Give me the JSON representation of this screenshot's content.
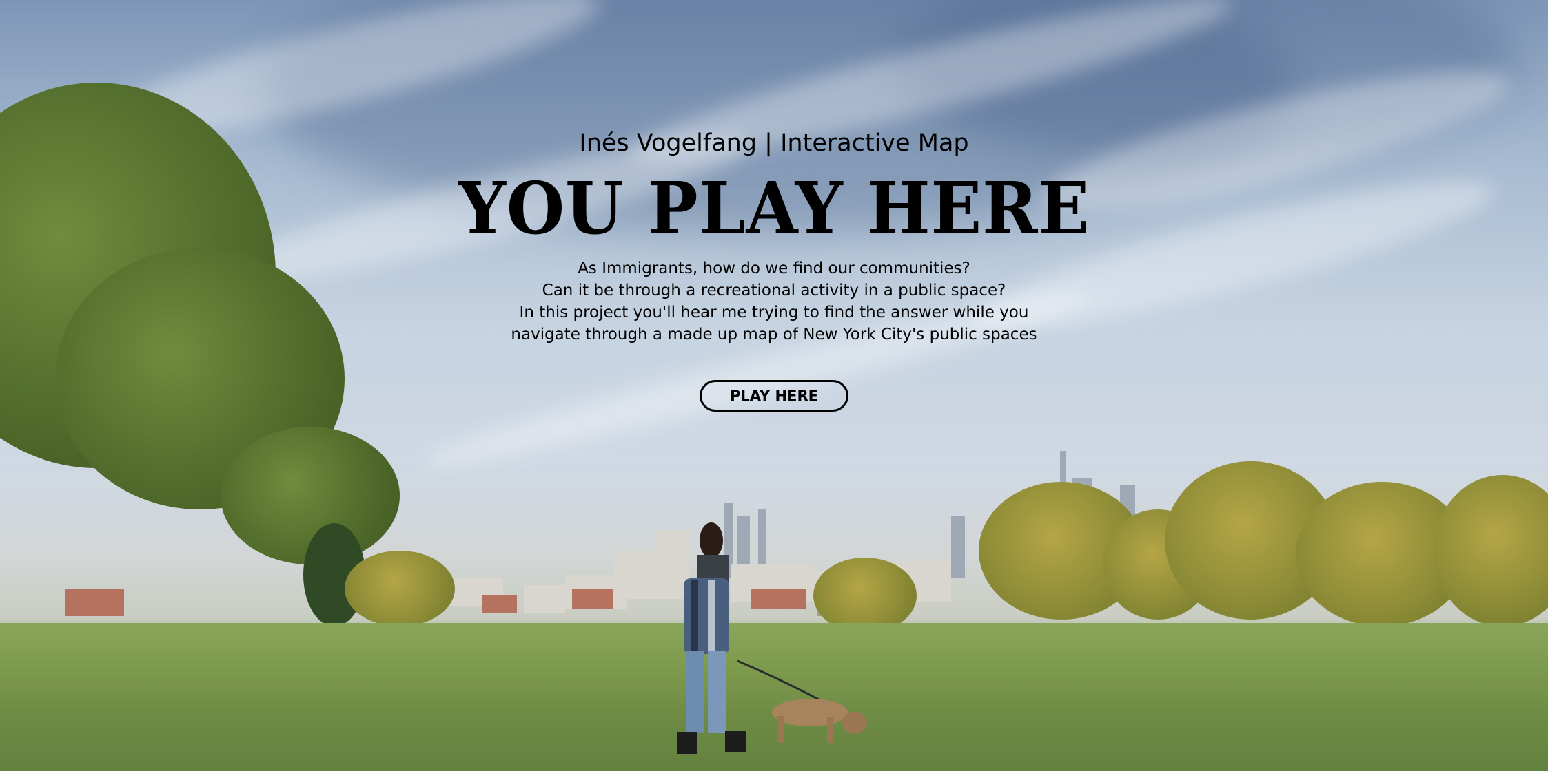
{
  "header": {
    "app_title": "Inés Vogelfang | Interactive Map"
  },
  "hero": {
    "heading": "YOU PLAY HERE",
    "intro_lines": [
      "As Immigrants, how do we find our communities?",
      "Can it be through a recreational activity in a public space?",
      "In this project you'll hear me trying to find the answer while you",
      "navigate through a made up map of New York City's public spaces"
    ],
    "cta_label": "PLAY HERE"
  },
  "colors": {
    "text": "#000000",
    "button_border": "#000000",
    "sky": "#c6d3e1",
    "grass": "#7d9b4e"
  }
}
